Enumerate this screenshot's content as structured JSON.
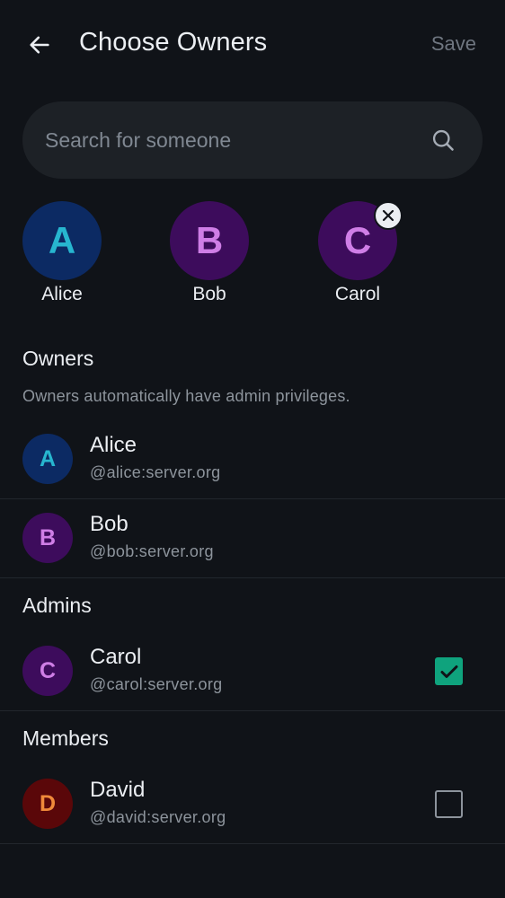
{
  "header": {
    "title": "Choose Owners",
    "save_label": "Save",
    "back_icon": "arrow-left-icon"
  },
  "search": {
    "placeholder": "Search for someone",
    "value": "",
    "icon": "search-icon"
  },
  "selected": [
    {
      "initial": "A",
      "name": "Alice",
      "color": "blue",
      "removable": false
    },
    {
      "initial": "B",
      "name": "Bob",
      "color": "purple",
      "removable": false
    },
    {
      "initial": "C",
      "name": "Carol",
      "color": "purple",
      "removable": true
    }
  ],
  "sections": {
    "owners": {
      "title": "Owners",
      "description": "Owners automatically have admin privileges.",
      "users": [
        {
          "initial": "A",
          "name": "Alice",
          "id": "@alice:server.org",
          "color": "blue"
        },
        {
          "initial": "B",
          "name": "Bob",
          "id": "@bob:server.org",
          "color": "purple"
        }
      ]
    },
    "admins": {
      "title": "Admins",
      "users": [
        {
          "initial": "C",
          "name": "Carol",
          "id": "@carol:server.org",
          "color": "purple",
          "checked": true
        }
      ]
    },
    "members": {
      "title": "Members",
      "users": [
        {
          "initial": "D",
          "name": "David",
          "id": "@david:server.org",
          "color": "red",
          "checked": false
        }
      ]
    }
  },
  "colors": {
    "background": "#101318",
    "accent": "#0fa37d",
    "avatar_blue_bg": "#0c2a63",
    "avatar_blue_fg": "#27b6cf",
    "avatar_purple_bg": "#3d0c5c",
    "avatar_purple_fg": "#cf7ee6",
    "avatar_red_bg": "#5a0709",
    "avatar_red_fg": "#f08a3a"
  }
}
